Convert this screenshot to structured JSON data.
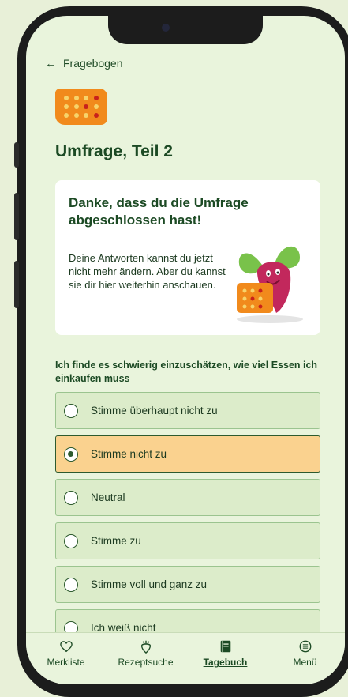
{
  "header": {
    "back_label": "Fragebogen",
    "title": "Umfrage, Teil 2"
  },
  "card": {
    "heading": "Danke, dass du die Umfrage abgeschlossen hast!",
    "body": "Deine Antworten kannst du jetzt nicht mehr ändern. Aber du kannst sie dir hier weiterhin anschauen."
  },
  "question": {
    "text": "Ich finde es schwierig einzuschätzen, wie viel Essen ich einkaufen muss",
    "options": [
      {
        "label": "Stimme überhaupt nicht zu",
        "selected": false
      },
      {
        "label": "Stimme nicht zu",
        "selected": true
      },
      {
        "label": "Neutral",
        "selected": false
      },
      {
        "label": "Stimme zu",
        "selected": false
      },
      {
        "label": "Stimme voll und ganz zu",
        "selected": false
      },
      {
        "label": "Ich weiß nicht",
        "selected": false
      }
    ]
  },
  "nav": {
    "items": [
      {
        "label": "Merkliste",
        "icon": "heart-icon"
      },
      {
        "label": "Rezeptsuche",
        "icon": "radish-icon"
      },
      {
        "label": "Tagebuch",
        "icon": "diary-icon",
        "active": true
      },
      {
        "label": "Menü",
        "icon": "menu-icon"
      }
    ]
  },
  "colors": {
    "background": "#e9f4dc",
    "accent_dark_green": "#1c4a24",
    "option_bg": "#dcecca",
    "selected_bg": "#fad28f",
    "icon_orange": "#f18a1c"
  }
}
